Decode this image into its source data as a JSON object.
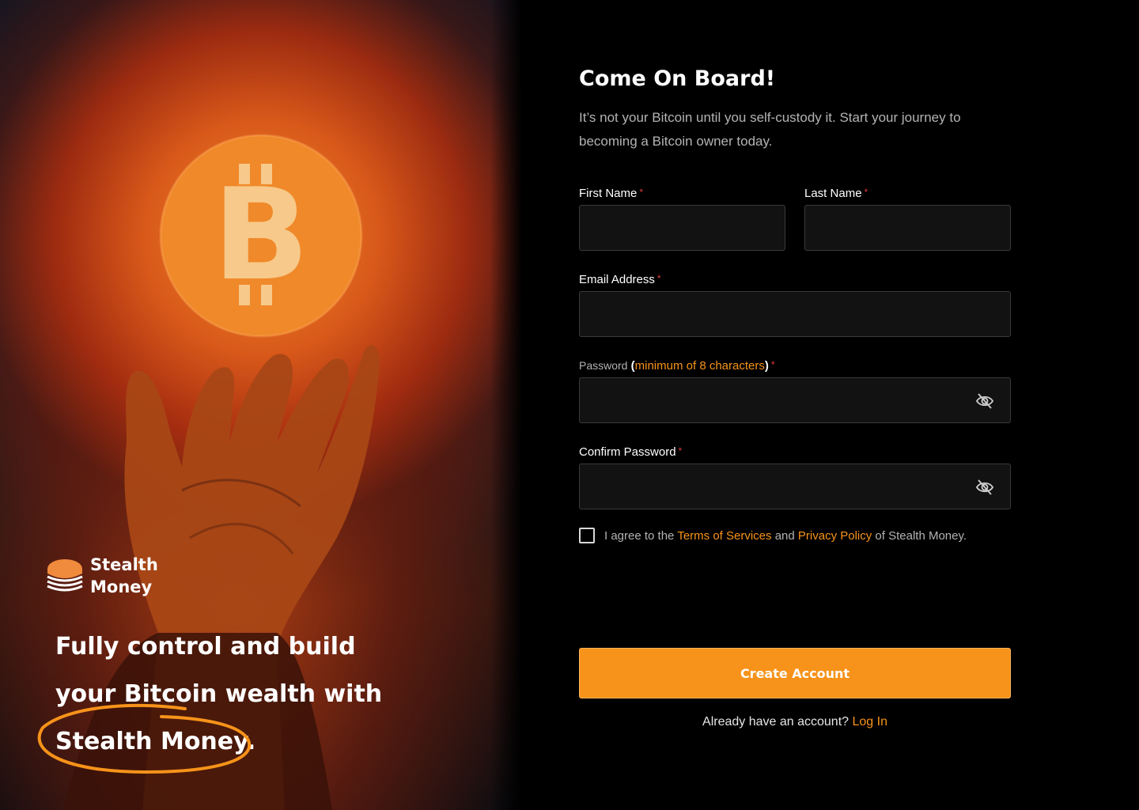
{
  "hero": {
    "logo_line1": "Stealth",
    "logo_line2": "Money",
    "tagline_line1": "Fully control and build",
    "tagline_line2": "your Bitcoin wealth with",
    "tagline_line3": "Stealth Money.",
    "bitcoin_symbol": "B",
    "accent_color": "#f7931a"
  },
  "form": {
    "title": "Come On Board!",
    "subtitle": "It’s not your Bitcoin until you self-custody it. Start your journey to becoming a Bitcoin owner today.",
    "required_marker": "*",
    "first_name": {
      "label": "First Name",
      "value": ""
    },
    "last_name": {
      "label": "Last Name",
      "value": ""
    },
    "email": {
      "label": "Email Address",
      "value": ""
    },
    "password": {
      "label": "Password",
      "paren_open": "(",
      "hint": "minimum of 8 characters",
      "paren_close": ")",
      "value": "",
      "toggle_icon": "eye-slash-icon"
    },
    "confirm_password": {
      "label": "Confirm Password",
      "value": "",
      "toggle_icon": "eye-slash-icon"
    },
    "agreement": {
      "checked": false,
      "prefix": "I agree to the",
      "terms_link": "Terms of Services",
      "and": "and",
      "privacy_link": "Privacy Policy",
      "suffix": "of Stealth Money."
    },
    "submit_label": "Create Account",
    "login_prompt": "Already have an account?",
    "login_link": "Log In"
  },
  "colors": {
    "accent": "#f7931a",
    "required": "#e23a3a",
    "input_bg": "#121212",
    "input_border": "#3a3a3a"
  }
}
